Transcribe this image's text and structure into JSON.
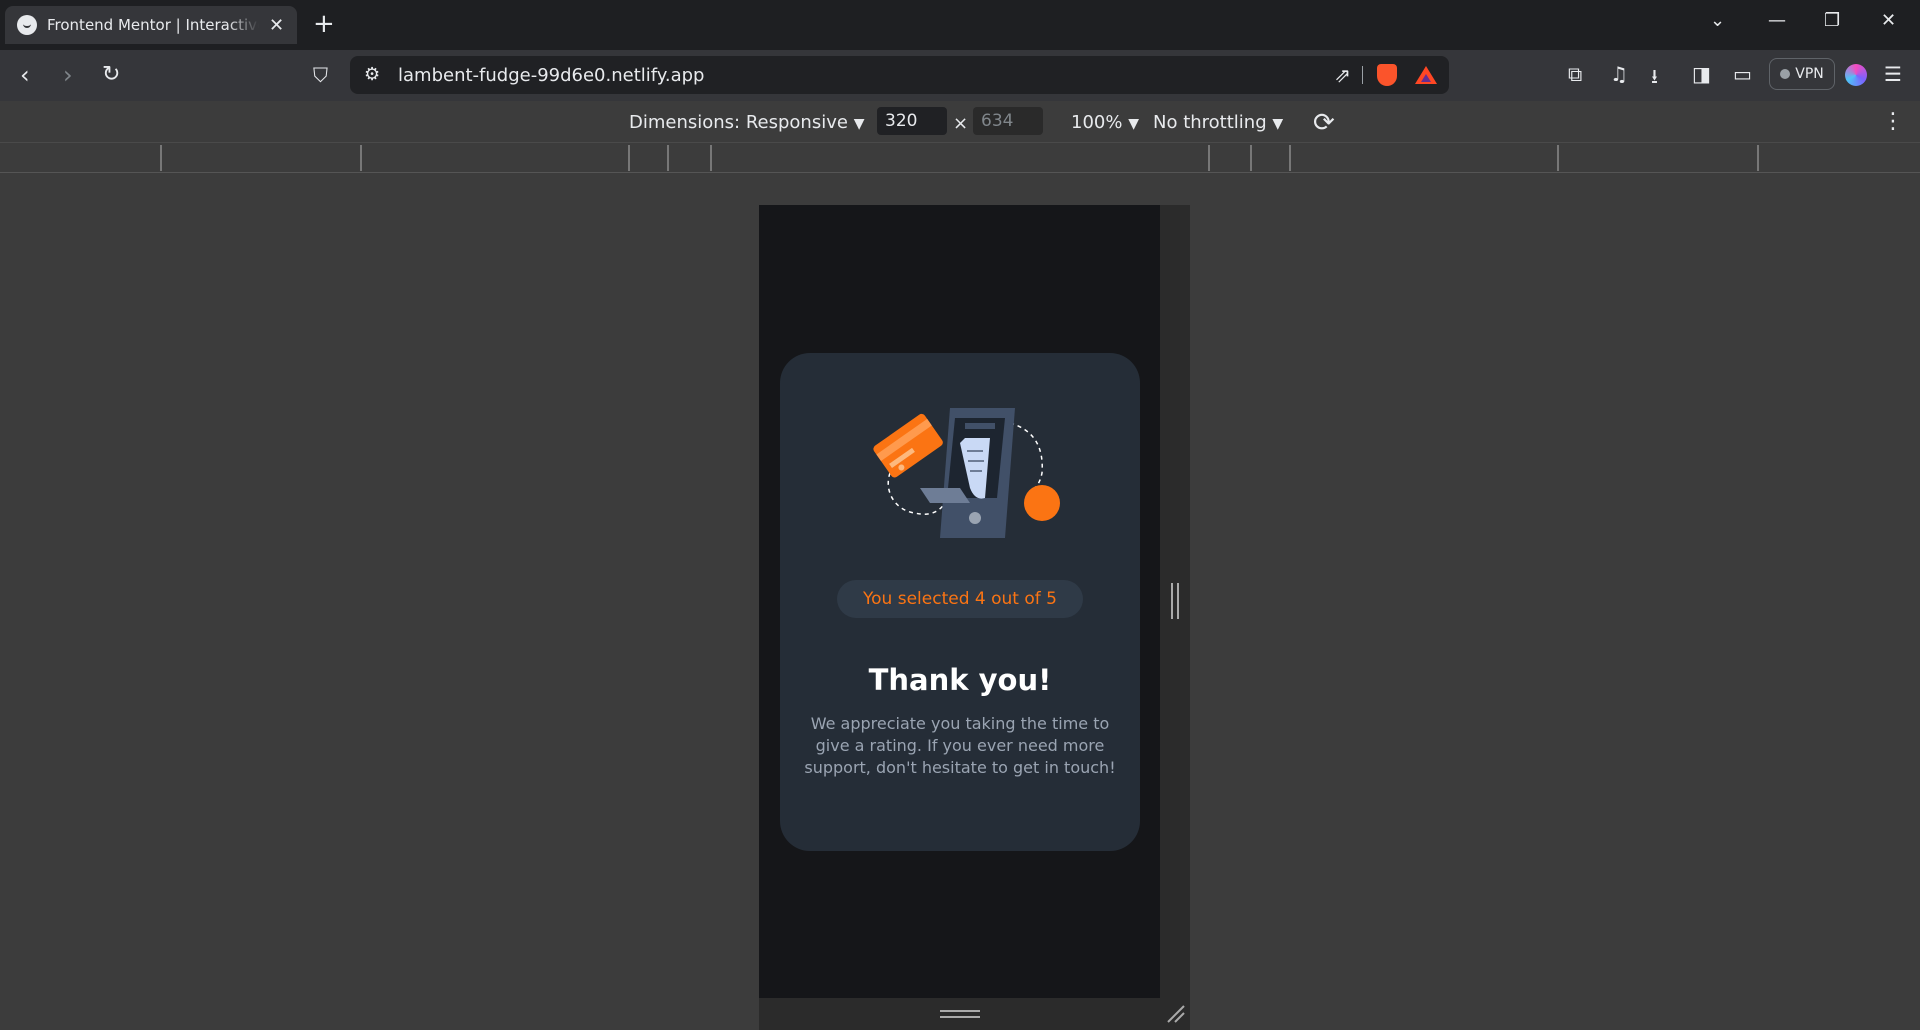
{
  "browser": {
    "tab_title": "Frontend Mentor | Interactive rating component",
    "url": "lambent-fudge-99d6e0.netlify.app",
    "vpn_label": "VPN"
  },
  "devtools": {
    "dimensions_label": "Dimensions: Responsive",
    "width": "320",
    "height_placeholder": "634",
    "times": "×",
    "zoom": "100%",
    "throttling": "No throttling"
  },
  "page": {
    "rating_badge": "You selected 4 out of 5",
    "heading": "Thank you!",
    "description": "We appreciate you taking the time to give a rating. If you ever need more support, don't hesitate to get in touch!"
  },
  "colors": {
    "card_bg": "#252d37",
    "accent_orange": "#fb7413",
    "page_bg": "#151619",
    "text_muted": "#9aa4b2"
  }
}
